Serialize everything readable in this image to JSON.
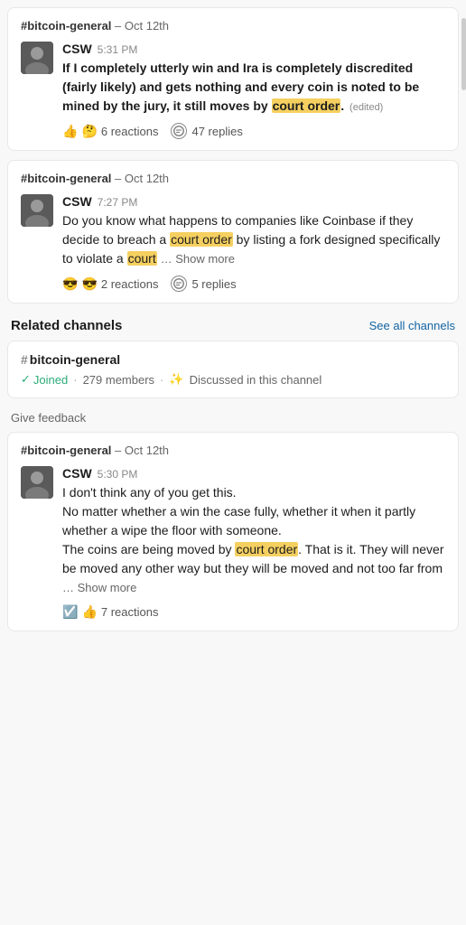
{
  "cards": [
    {
      "id": "card1",
      "channel": "#bitcoin-general",
      "date": "Oct 12th",
      "author": "CSW",
      "time": "5:31 PM",
      "message_parts": [
        {
          "type": "text",
          "content": "If I completely utterly win and Ira is completely discredited (fairly likely) and gets nothing and every coin is noted to be mined by the jury, it still moves by "
        },
        {
          "type": "highlight",
          "content": "court order"
        },
        {
          "type": "text",
          "content": " (edited)"
        }
      ],
      "message_bold": true,
      "edited": true,
      "reactions": [
        "👍",
        "🤔"
      ],
      "reaction_count": "6 reactions",
      "reply_count": "47 replies"
    },
    {
      "id": "card2",
      "channel": "#bitcoin-general",
      "date": "Oct 12th",
      "author": "CSW",
      "time": "7:27 PM",
      "message_plain": "Do you know what happens to companies like Coinbase if they decide to breach a ",
      "highlight1": "court order",
      "message_mid": " by listing a fork designed specifically to violate a ",
      "highlight2": "court",
      "show_more": true,
      "reactions": [
        "😎",
        "😎"
      ],
      "reaction_count": "2 reactions",
      "reply_count": "5 replies"
    }
  ],
  "related_channels": {
    "section_title": "Related channels",
    "see_all_label": "See all channels",
    "channel": {
      "name": "#bitcoin-general",
      "hash": "#",
      "joined": true,
      "joined_label": "Joined",
      "members_count": "279 members",
      "discussed_label": "Discussed in this channel"
    }
  },
  "give_feedback": {
    "label": "Give feedback"
  },
  "bottom_card": {
    "channel": "#bitcoin-general",
    "date": "Oct 12th",
    "author": "CSW",
    "time": "5:30 PM",
    "message_lines": [
      "I don't think any of you get this.",
      "No matter whether a win the case fully, whether it when it partly whether a wipe the floor with someone.",
      "The coins are being moved by "
    ],
    "highlight1": "court order",
    "message_after_highlight": ". That is it. They will never be moved any other way but they will be moved and not too far from",
    "show_more": true,
    "reactions": [
      "☑️",
      "👍"
    ],
    "reaction_count": "7 reactions"
  }
}
